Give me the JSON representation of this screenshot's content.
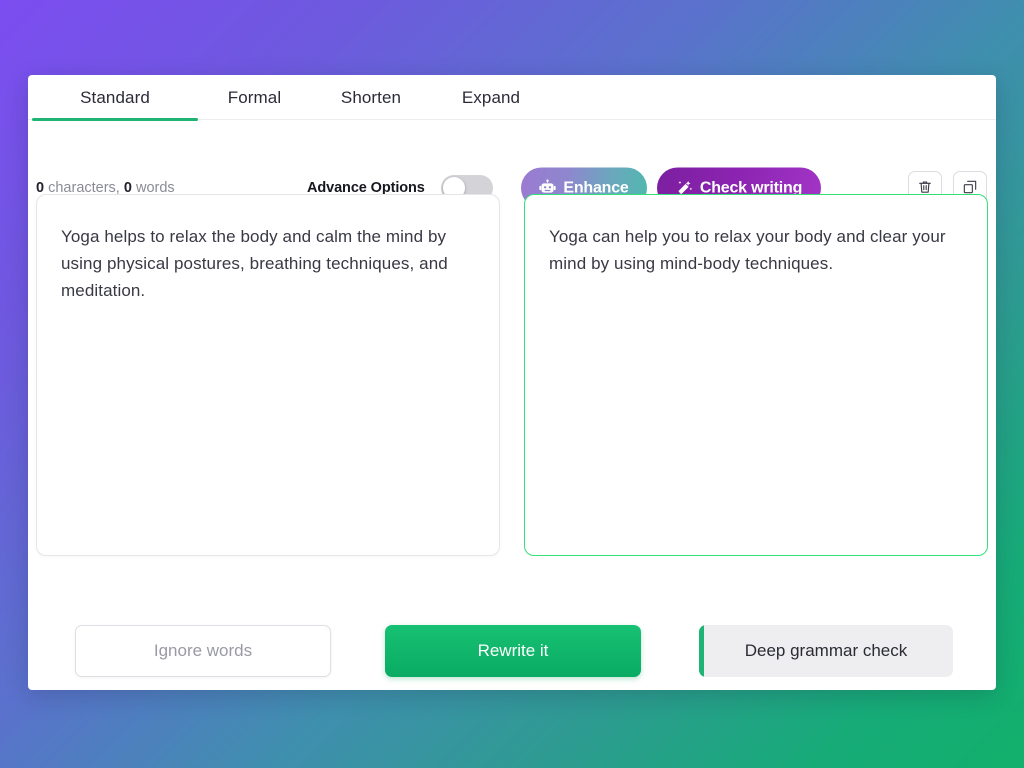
{
  "tabs": [
    {
      "label": "Standard",
      "active": true
    },
    {
      "label": "Formal",
      "active": false
    },
    {
      "label": "Shorten",
      "active": false
    },
    {
      "label": "Expand",
      "active": false
    }
  ],
  "toolbar": {
    "char_count": "0",
    "char_label": "characters,",
    "word_count": "0",
    "word_label": "words",
    "advance_options_label": "Advance Options",
    "advance_options_state": "off",
    "enhance_label": "Enhance",
    "check_writing_label": "Check writing",
    "delete_icon": "trash-icon",
    "copy_icon": "copy-icon",
    "enhance_icon": "robot-icon",
    "check_writing_icon": "magic-wand-icon"
  },
  "panels": {
    "source_text": "Yoga helps to relax the body and calm the mind by using physical postures, breathing techniques, and meditation.",
    "result_text": "Yoga can help you to relax your body and clear your mind by using mind-body techniques."
  },
  "footer": {
    "ignore_words_label": "Ignore words",
    "rewrite_label": "Rewrite it",
    "deep_grammar_label": "Deep grammar check"
  },
  "colors": {
    "accent_green": "#1fb473",
    "result_border": "#35e07a",
    "rewrite_green": "#12b86e",
    "check_purple": "#8a24b0",
    "bg_purple": "#7c4df0",
    "bg_teal": "#31959a",
    "bg_green": "#11b06b",
    "bg_blue": "#5a72cc"
  }
}
